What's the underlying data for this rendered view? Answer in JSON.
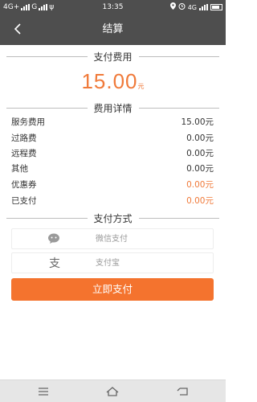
{
  "status_bar": {
    "left_text": "4G+ᵢₗ G ᵢₗ ψ",
    "net1": "4G+",
    "net2": "G",
    "time": "13:35",
    "right_net": "4G"
  },
  "header": {
    "back_icon": "chevron-left-icon",
    "title": "结算"
  },
  "sections": {
    "fee": "支付费用",
    "details": "费用详情",
    "method": "支付方式"
  },
  "amount": {
    "value": "15.00",
    "unit": "元"
  },
  "details": [
    {
      "label": "服务费用",
      "value": "15.00元",
      "highlight": false
    },
    {
      "label": "过路费",
      "value": "0.00元",
      "highlight": false
    },
    {
      "label": "远程费",
      "value": "0.00元",
      "highlight": false
    },
    {
      "label": "其他",
      "value": "0.00元",
      "highlight": false
    },
    {
      "label": "优惠券",
      "value": "0.00元",
      "highlight": true
    },
    {
      "label": "已支付",
      "value": "0.00元",
      "highlight": true
    }
  ],
  "payment_methods": [
    {
      "name": "微信支付",
      "icon": "wechat-icon"
    },
    {
      "name": "支付宝",
      "icon": "alipay-icon"
    }
  ],
  "pay_button": "立即支付",
  "colors": {
    "header_bg": "#4e4e4e",
    "accent": "#f4732e",
    "amount": "#f07a3a"
  },
  "nav_icons": [
    "menu-icon",
    "home-icon",
    "back-icon"
  ]
}
